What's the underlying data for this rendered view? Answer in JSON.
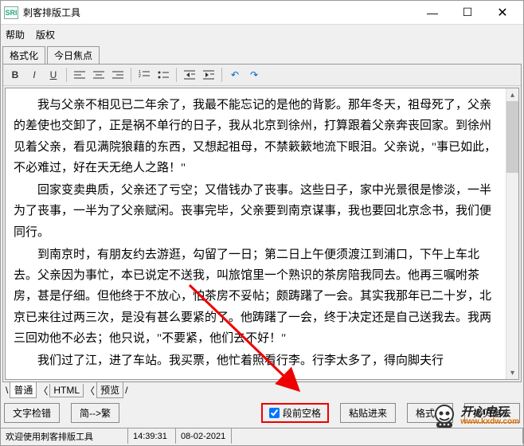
{
  "window": {
    "icon_text": "SRI",
    "title": "刺客排版工具"
  },
  "menu": {
    "help": "帮助",
    "copyright": "版权"
  },
  "top_tabs": {
    "format": "格式化",
    "today": "今日焦点"
  },
  "editor": {
    "p1": "我与父亲不相见已二年余了，我最不能忘记的是他的背影。那年冬天，祖母死了，父亲的差使也交卸了，正是祸不单行的日子，我从北京到徐州，打算跟着父亲奔丧回家。到徐州见着父亲，看见满院狼藉的东西，又想起祖母，不禁簌簌地流下眼泪。父亲说，\"事已如此，不必难过，好在天无绝人之路！\"",
    "p2": "回家变卖典质，父亲还了亏空；又借钱办了丧事。这些日子，家中光景很是惨淡，一半为了丧事，一半为了父亲赋闲。丧事完毕，父亲要到南京谋事，我也要回北京念书，我们便同行。",
    "p3": "到南京时，有朋友约去游逛，勾留了一日；第二日上午便须渡江到浦口，下午上车北去。父亲因为事忙，本已说定不送我，叫旅馆里一个熟识的茶房陪我同去。他再三嘱咐茶房，甚是仔细。但他终于不放心，怕茶房不妥帖；颇踌躇了一会。其实我那年已二十岁，北京已来往过两三次，是没有甚么要紧的了。他踌躇了一会，终于决定还是自己送我去。我两三回劝他不必去；他只说，\"不要紧，他们去不好！\"",
    "p4": "我们过了江，进了车站。我买票，他忙着照看行李。行李太多了，得向脚夫行"
  },
  "bottom_tabs": {
    "normal": "普通",
    "html": "HTML",
    "preview": "预览"
  },
  "buttons": {
    "spellcheck": "文字检错",
    "simp2trad": "简-->繁",
    "checkbox_label": "段前空格",
    "paste": "粘贴进来",
    "format": "格式化",
    "copyout": "拷贝出去"
  },
  "status": {
    "welcome": "欢迎使用刺客排版工具",
    "time": "14:39:31",
    "date": "08-02-2021"
  },
  "watermark": {
    "cn": "开心电玩",
    "url": "www.kxdw.com"
  }
}
